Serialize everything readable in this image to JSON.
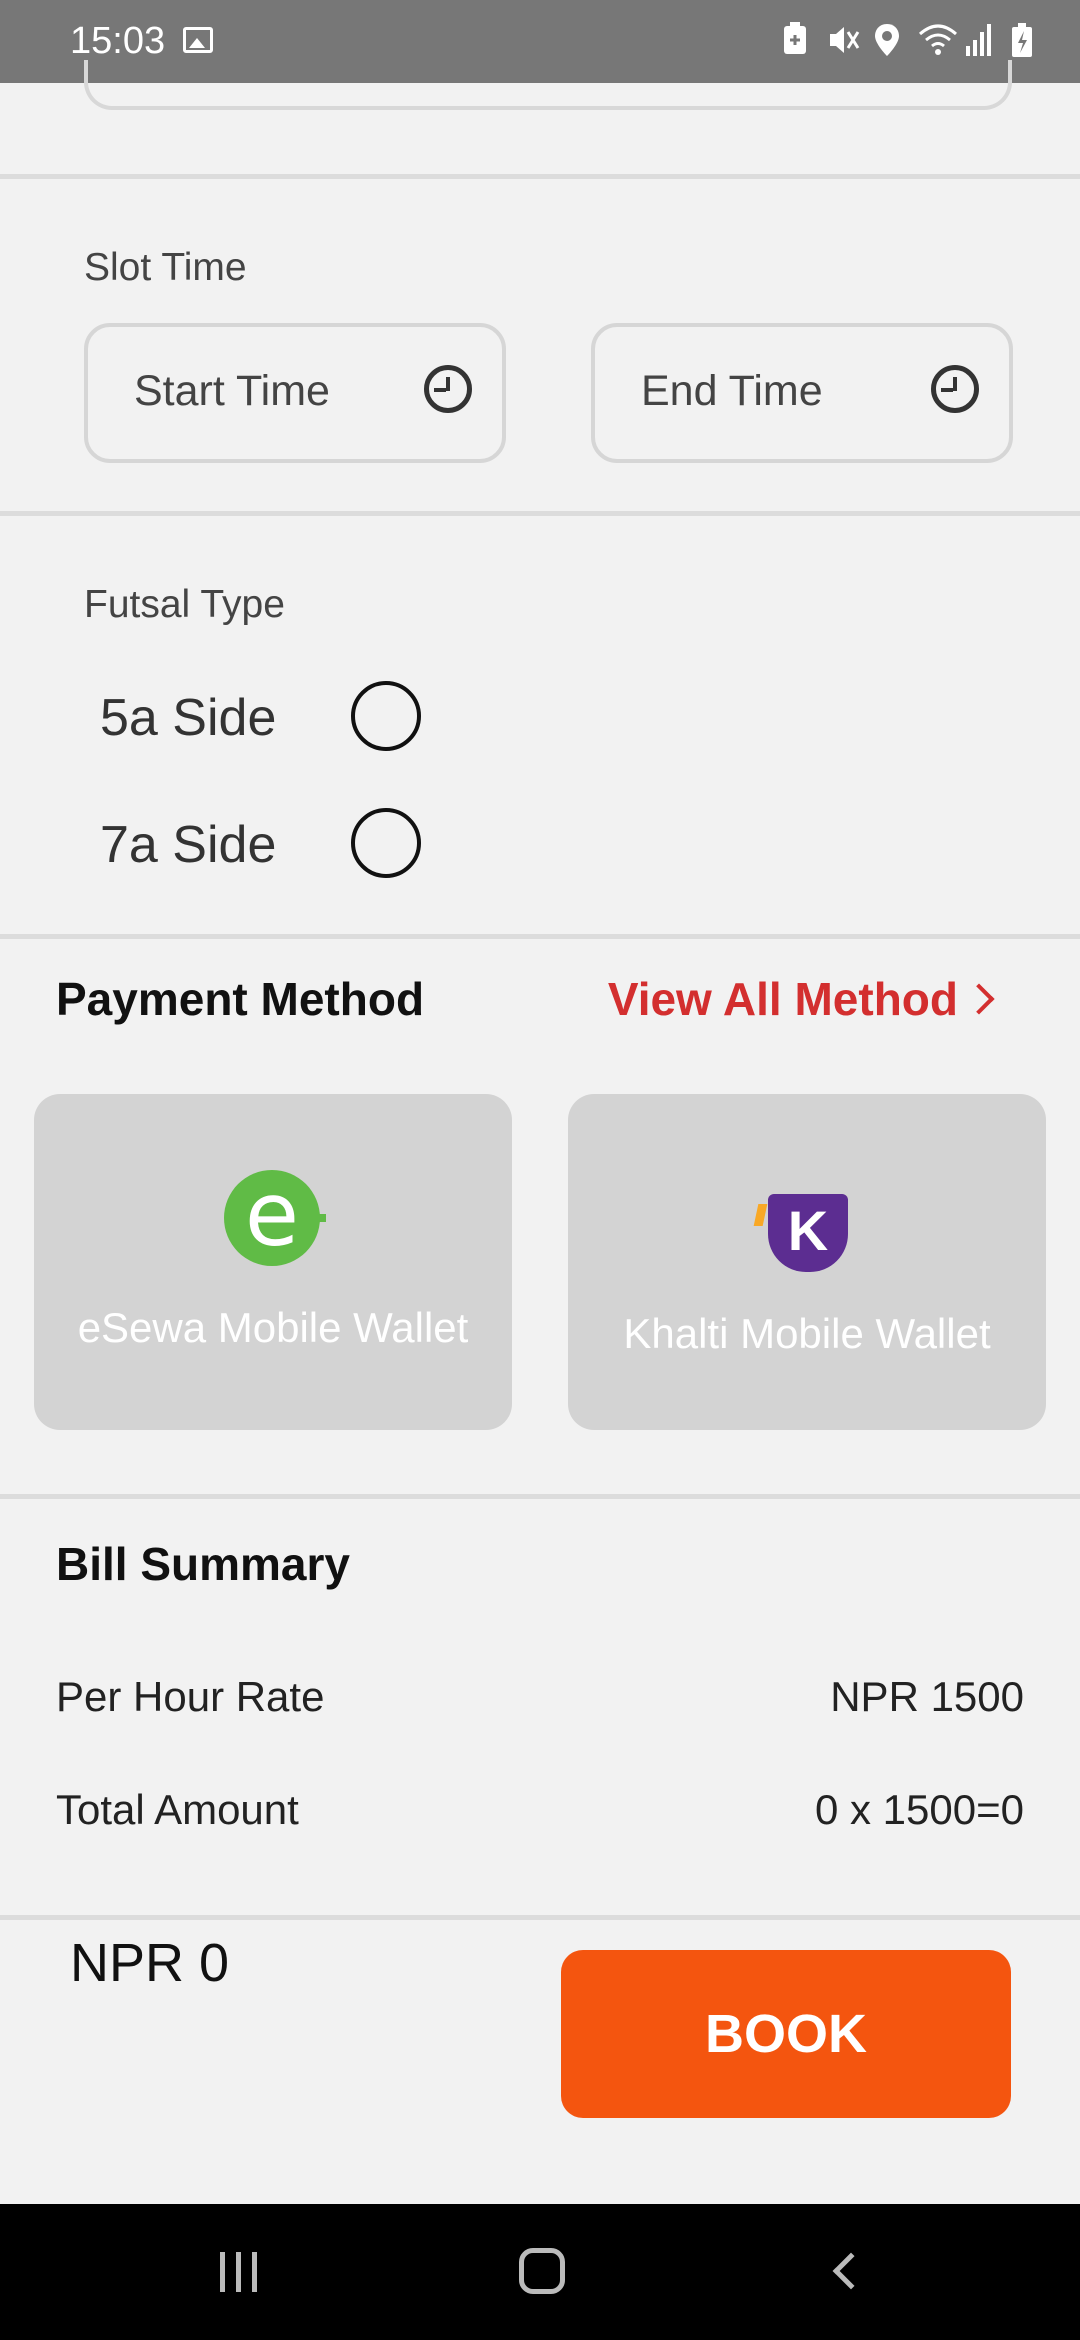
{
  "status_bar": {
    "time": "15:03",
    "left_icons": [
      "image-icon"
    ],
    "right_icons": [
      "battery-saver-icon",
      "mute-icon",
      "location-icon",
      "wifi-icon",
      "signal-icon",
      "battery-charging-icon"
    ]
  },
  "slot_time": {
    "label": "Slot Time",
    "start_placeholder": "Start Time",
    "end_placeholder": "End Time"
  },
  "futsal_type": {
    "label": "Futsal Type",
    "options": [
      {
        "label": "5a Side",
        "selected": false
      },
      {
        "label": "7a Side",
        "selected": false
      }
    ]
  },
  "payment": {
    "title": "Payment Method",
    "view_all": "View All Method",
    "wallets": [
      {
        "label": "eSewa Mobile Wallet",
        "logo_letter": "e",
        "logo_color": "#60bb46"
      },
      {
        "label": "Khalti Mobile Wallet",
        "logo_letter": "K",
        "logo_color": "#5c2d91"
      }
    ]
  },
  "bill_summary": {
    "title": "Bill Summary",
    "rows": [
      {
        "label": "Per Hour Rate",
        "value": "NPR 1500"
      },
      {
        "label": "Total Amount",
        "value": "0 x 1500=0"
      }
    ]
  },
  "footer": {
    "total": "NPR 0",
    "book_label": "BOOK",
    "book_color": "#f4550f"
  },
  "colors": {
    "accent_red": "#d32f2f",
    "background": "#f2f2f2",
    "card": "#d3d3d3"
  }
}
